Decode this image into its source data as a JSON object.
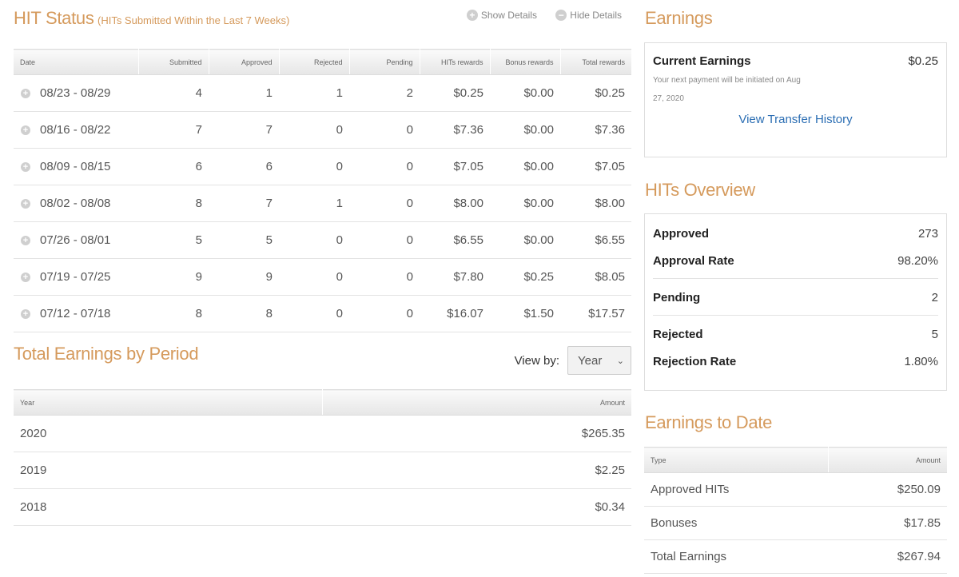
{
  "hit_status": {
    "title": "HIT Status",
    "subtitle": "(HITs Submitted Within the Last 7 Weeks)",
    "show_details": "Show Details",
    "hide_details": "Hide Details",
    "columns": [
      "Date",
      "Submitted",
      "Approved",
      "Rejected",
      "Pending",
      "HITs rewards",
      "Bonus rewards",
      "Total rewards"
    ],
    "rows": [
      {
        "date": "08/23 - 08/29",
        "submitted": "4",
        "approved": "1",
        "rejected": "1",
        "pending": "2",
        "hits_rewards": "$0.25",
        "bonus_rewards": "$0.00",
        "total_rewards": "$0.25"
      },
      {
        "date": "08/16 - 08/22",
        "submitted": "7",
        "approved": "7",
        "rejected": "0",
        "pending": "0",
        "hits_rewards": "$7.36",
        "bonus_rewards": "$0.00",
        "total_rewards": "$7.36"
      },
      {
        "date": "08/09 - 08/15",
        "submitted": "6",
        "approved": "6",
        "rejected": "0",
        "pending": "0",
        "hits_rewards": "$7.05",
        "bonus_rewards": "$0.00",
        "total_rewards": "$7.05"
      },
      {
        "date": "08/02 - 08/08",
        "submitted": "8",
        "approved": "7",
        "rejected": "1",
        "pending": "0",
        "hits_rewards": "$8.00",
        "bonus_rewards": "$0.00",
        "total_rewards": "$8.00"
      },
      {
        "date": "07/26 - 08/01",
        "submitted": "5",
        "approved": "5",
        "rejected": "0",
        "pending": "0",
        "hits_rewards": "$6.55",
        "bonus_rewards": "$0.00",
        "total_rewards": "$6.55"
      },
      {
        "date": "07/19 - 07/25",
        "submitted": "9",
        "approved": "9",
        "rejected": "0",
        "pending": "0",
        "hits_rewards": "$7.80",
        "bonus_rewards": "$0.25",
        "total_rewards": "$8.05"
      },
      {
        "date": "07/12 - 07/18",
        "submitted": "8",
        "approved": "8",
        "rejected": "0",
        "pending": "0",
        "hits_rewards": "$16.07",
        "bonus_rewards": "$1.50",
        "total_rewards": "$17.57"
      }
    ]
  },
  "period": {
    "title": "Total Earnings by Period",
    "view_by_label": "View by:",
    "view_by_value": "Year",
    "columns": [
      "Year",
      "Amount"
    ],
    "rows": [
      {
        "year": "2020",
        "amount": "$265.35"
      },
      {
        "year": "2019",
        "amount": "$2.25"
      },
      {
        "year": "2018",
        "amount": "$0.34"
      }
    ]
  },
  "earnings": {
    "title": "Earnings",
    "current_label": "Current Earnings",
    "current_value": "$0.25",
    "note": "Your next payment will be initiated on Aug 27, 2020",
    "transfer_link": "View Transfer History"
  },
  "overview": {
    "title": "HITs Overview",
    "approved_label": "Approved",
    "approved_value": "273",
    "approval_rate_label": "Approval Rate",
    "approval_rate_value": "98.20%",
    "pending_label": "Pending",
    "pending_value": "2",
    "rejected_label": "Rejected",
    "rejected_value": "5",
    "rejection_rate_label": "Rejection Rate",
    "rejection_rate_value": "1.80%"
  },
  "to_date": {
    "title": "Earnings to Date",
    "columns": [
      "Type",
      "Amount"
    ],
    "rows": [
      {
        "type": "Approved HITs",
        "amount": "$250.09"
      },
      {
        "type": "Bonuses",
        "amount": "$17.85"
      },
      {
        "type": "Total Earnings",
        "amount": "$267.94"
      }
    ]
  },
  "colors": {
    "accent": "#d59a5c",
    "link": "#2a6db3"
  }
}
